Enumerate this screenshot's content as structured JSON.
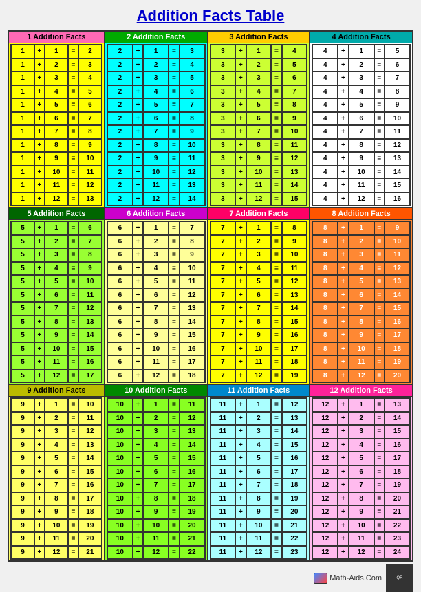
{
  "title": "Addition Facts Table",
  "sections": [
    {
      "id": 1,
      "header": "1 Addition Facts",
      "colorClass": "s1",
      "base": 1,
      "facts": [
        {
          "a": 1,
          "op": "+",
          "b": 1,
          "eq": "=",
          "r": 2
        },
        {
          "a": 1,
          "op": "+",
          "b": 2,
          "eq": "=",
          "r": 3
        },
        {
          "a": 1,
          "op": "+",
          "b": 3,
          "eq": "=",
          "r": 4
        },
        {
          "a": 1,
          "op": "+",
          "b": 4,
          "eq": "=",
          "r": 5
        },
        {
          "a": 1,
          "op": "+",
          "b": 5,
          "eq": "=",
          "r": 6
        },
        {
          "a": 1,
          "op": "+",
          "b": 6,
          "eq": "=",
          "r": 7
        },
        {
          "a": 1,
          "op": "+",
          "b": 7,
          "eq": "=",
          "r": 8
        },
        {
          "a": 1,
          "op": "+",
          "b": 8,
          "eq": "=",
          "r": 9
        },
        {
          "a": 1,
          "op": "+",
          "b": 9,
          "eq": "=",
          "r": 10
        },
        {
          "a": 1,
          "op": "+",
          "b": 10,
          "eq": "=",
          "r": 11
        },
        {
          "a": 1,
          "op": "+",
          "b": 11,
          "eq": "=",
          "r": 12
        },
        {
          "a": 1,
          "op": "+",
          "b": 12,
          "eq": "=",
          "r": 13
        }
      ]
    },
    {
      "id": 2,
      "header": "2 Addition Facts",
      "colorClass": "s2",
      "base": 2,
      "facts": [
        {
          "a": 2,
          "op": "+",
          "b": 1,
          "eq": "=",
          "r": 3
        },
        {
          "a": 2,
          "op": "+",
          "b": 2,
          "eq": "=",
          "r": 4
        },
        {
          "a": 2,
          "op": "+",
          "b": 3,
          "eq": "=",
          "r": 5
        },
        {
          "a": 2,
          "op": "+",
          "b": 4,
          "eq": "=",
          "r": 6
        },
        {
          "a": 2,
          "op": "+",
          "b": 5,
          "eq": "=",
          "r": 7
        },
        {
          "a": 2,
          "op": "+",
          "b": 6,
          "eq": "=",
          "r": 8
        },
        {
          "a": 2,
          "op": "+",
          "b": 7,
          "eq": "=",
          "r": 9
        },
        {
          "a": 2,
          "op": "+",
          "b": 8,
          "eq": "=",
          "r": 10
        },
        {
          "a": 2,
          "op": "+",
          "b": 9,
          "eq": "=",
          "r": 11
        },
        {
          "a": 2,
          "op": "+",
          "b": 10,
          "eq": "=",
          "r": 12
        },
        {
          "a": 2,
          "op": "+",
          "b": 11,
          "eq": "=",
          "r": 13
        },
        {
          "a": 2,
          "op": "+",
          "b": 12,
          "eq": "=",
          "r": 14
        }
      ]
    },
    {
      "id": 3,
      "header": "3 Addition Facts",
      "colorClass": "s3",
      "base": 3,
      "facts": [
        {
          "a": 3,
          "op": "+",
          "b": 1,
          "eq": "=",
          "r": 4
        },
        {
          "a": 3,
          "op": "+",
          "b": 2,
          "eq": "=",
          "r": 5
        },
        {
          "a": 3,
          "op": "+",
          "b": 3,
          "eq": "=",
          "r": 6
        },
        {
          "a": 3,
          "op": "+",
          "b": 4,
          "eq": "=",
          "r": 7
        },
        {
          "a": 3,
          "op": "+",
          "b": 5,
          "eq": "=",
          "r": 8
        },
        {
          "a": 3,
          "op": "+",
          "b": 6,
          "eq": "=",
          "r": 9
        },
        {
          "a": 3,
          "op": "+",
          "b": 7,
          "eq": "=",
          "r": 10
        },
        {
          "a": 3,
          "op": "+",
          "b": 8,
          "eq": "=",
          "r": 11
        },
        {
          "a": 3,
          "op": "+",
          "b": 9,
          "eq": "=",
          "r": 12
        },
        {
          "a": 3,
          "op": "+",
          "b": 10,
          "eq": "=",
          "r": 13
        },
        {
          "a": 3,
          "op": "+",
          "b": 11,
          "eq": "=",
          "r": 14
        },
        {
          "a": 3,
          "op": "+",
          "b": 12,
          "eq": "=",
          "r": 15
        }
      ]
    },
    {
      "id": 4,
      "header": "4 Addition Facts",
      "colorClass": "s4",
      "base": 4,
      "facts": [
        {
          "a": 4,
          "op": "+",
          "b": 1,
          "eq": "=",
          "r": 5
        },
        {
          "a": 4,
          "op": "+",
          "b": 2,
          "eq": "=",
          "r": 6
        },
        {
          "a": 4,
          "op": "+",
          "b": 3,
          "eq": "=",
          "r": 7
        },
        {
          "a": 4,
          "op": "+",
          "b": 4,
          "eq": "=",
          "r": 8
        },
        {
          "a": 4,
          "op": "+",
          "b": 5,
          "eq": "=",
          "r": 9
        },
        {
          "a": 4,
          "op": "+",
          "b": 6,
          "eq": "=",
          "r": 10
        },
        {
          "a": 4,
          "op": "+",
          "b": 7,
          "eq": "=",
          "r": 11
        },
        {
          "a": 4,
          "op": "+",
          "b": 8,
          "eq": "=",
          "r": 12
        },
        {
          "a": 4,
          "op": "+",
          "b": 9,
          "eq": "=",
          "r": 13
        },
        {
          "a": 4,
          "op": "+",
          "b": 10,
          "eq": "=",
          "r": 14
        },
        {
          "a": 4,
          "op": "+",
          "b": 11,
          "eq": "=",
          "r": 15
        },
        {
          "a": 4,
          "op": "+",
          "b": 12,
          "eq": "=",
          "r": 16
        }
      ]
    },
    {
      "id": 5,
      "header": "5 Addition Facts",
      "colorClass": "s5",
      "base": 5,
      "facts": [
        {
          "a": 5,
          "op": "+",
          "b": 1,
          "eq": "=",
          "r": 6
        },
        {
          "a": 5,
          "op": "+",
          "b": 2,
          "eq": "=",
          "r": 7
        },
        {
          "a": 5,
          "op": "+",
          "b": 3,
          "eq": "=",
          "r": 8
        },
        {
          "a": 5,
          "op": "+",
          "b": 4,
          "eq": "=",
          "r": 9
        },
        {
          "a": 5,
          "op": "+",
          "b": 5,
          "eq": "=",
          "r": 10
        },
        {
          "a": 5,
          "op": "+",
          "b": 6,
          "eq": "=",
          "r": 11
        },
        {
          "a": 5,
          "op": "+",
          "b": 7,
          "eq": "=",
          "r": 12
        },
        {
          "a": 5,
          "op": "+",
          "b": 8,
          "eq": "=",
          "r": 13
        },
        {
          "a": 5,
          "op": "+",
          "b": 9,
          "eq": "=",
          "r": 14
        },
        {
          "a": 5,
          "op": "+",
          "b": 10,
          "eq": "=",
          "r": 15
        },
        {
          "a": 5,
          "op": "+",
          "b": 11,
          "eq": "=",
          "r": 16
        },
        {
          "a": 5,
          "op": "+",
          "b": 12,
          "eq": "=",
          "r": 17
        }
      ]
    },
    {
      "id": 6,
      "header": "6 Addition Facts",
      "colorClass": "s6",
      "base": 6,
      "facts": [
        {
          "a": 6,
          "op": "+",
          "b": 1,
          "eq": "=",
          "r": 7
        },
        {
          "a": 6,
          "op": "+",
          "b": 2,
          "eq": "=",
          "r": 8
        },
        {
          "a": 6,
          "op": "+",
          "b": 3,
          "eq": "=",
          "r": 9
        },
        {
          "a": 6,
          "op": "+",
          "b": 4,
          "eq": "=",
          "r": 10
        },
        {
          "a": 6,
          "op": "+",
          "b": 5,
          "eq": "=",
          "r": 11
        },
        {
          "a": 6,
          "op": "+",
          "b": 6,
          "eq": "=",
          "r": 12
        },
        {
          "a": 6,
          "op": "+",
          "b": 7,
          "eq": "=",
          "r": 13
        },
        {
          "a": 6,
          "op": "+",
          "b": 8,
          "eq": "=",
          "r": 14
        },
        {
          "a": 6,
          "op": "+",
          "b": 9,
          "eq": "=",
          "r": 15
        },
        {
          "a": 6,
          "op": "+",
          "b": 10,
          "eq": "=",
          "r": 16
        },
        {
          "a": 6,
          "op": "+",
          "b": 11,
          "eq": "=",
          "r": 17
        },
        {
          "a": 6,
          "op": "+",
          "b": 12,
          "eq": "=",
          "r": 18
        }
      ]
    },
    {
      "id": 7,
      "header": "7 Addition Facts",
      "colorClass": "s7",
      "base": 7,
      "facts": [
        {
          "a": 7,
          "op": "+",
          "b": 1,
          "eq": "=",
          "r": 8
        },
        {
          "a": 7,
          "op": "+",
          "b": 2,
          "eq": "=",
          "r": 9
        },
        {
          "a": 7,
          "op": "+",
          "b": 3,
          "eq": "=",
          "r": 10
        },
        {
          "a": 7,
          "op": "+",
          "b": 4,
          "eq": "=",
          "r": 11
        },
        {
          "a": 7,
          "op": "+",
          "b": 5,
          "eq": "=",
          "r": 12
        },
        {
          "a": 7,
          "op": "+",
          "b": 6,
          "eq": "=",
          "r": 13
        },
        {
          "a": 7,
          "op": "+",
          "b": 7,
          "eq": "=",
          "r": 14
        },
        {
          "a": 7,
          "op": "+",
          "b": 8,
          "eq": "=",
          "r": 15
        },
        {
          "a": 7,
          "op": "+",
          "b": 9,
          "eq": "=",
          "r": 16
        },
        {
          "a": 7,
          "op": "+",
          "b": 10,
          "eq": "=",
          "r": 17
        },
        {
          "a": 7,
          "op": "+",
          "b": 11,
          "eq": "=",
          "r": 18
        },
        {
          "a": 7,
          "op": "+",
          "b": 12,
          "eq": "=",
          "r": 19
        }
      ]
    },
    {
      "id": 8,
      "header": "8 Addition Facts",
      "colorClass": "s8",
      "base": 8,
      "facts": [
        {
          "a": 8,
          "op": "+",
          "b": 1,
          "eq": "=",
          "r": 9
        },
        {
          "a": 8,
          "op": "+",
          "b": 2,
          "eq": "=",
          "r": 10
        },
        {
          "a": 8,
          "op": "+",
          "b": 3,
          "eq": "=",
          "r": 11
        },
        {
          "a": 8,
          "op": "+",
          "b": 4,
          "eq": "=",
          "r": 12
        },
        {
          "a": 8,
          "op": "+",
          "b": 5,
          "eq": "=",
          "r": 13
        },
        {
          "a": 8,
          "op": "+",
          "b": 6,
          "eq": "=",
          "r": 14
        },
        {
          "a": 8,
          "op": "+",
          "b": 7,
          "eq": "=",
          "r": 15
        },
        {
          "a": 8,
          "op": "+",
          "b": 8,
          "eq": "=",
          "r": 16
        },
        {
          "a": 8,
          "op": "+",
          "b": 9,
          "eq": "=",
          "r": 17
        },
        {
          "a": 8,
          "op": "+",
          "b": 10,
          "eq": "=",
          "r": 18
        },
        {
          "a": 8,
          "op": "+",
          "b": 11,
          "eq": "=",
          "r": 19
        },
        {
          "a": 8,
          "op": "+",
          "b": 12,
          "eq": "=",
          "r": 20
        }
      ]
    },
    {
      "id": 9,
      "header": "9 Addition Facts",
      "colorClass": "s9",
      "base": 9,
      "facts": [
        {
          "a": 9,
          "op": "+",
          "b": 1,
          "eq": "=",
          "r": 10
        },
        {
          "a": 9,
          "op": "+",
          "b": 2,
          "eq": "=",
          "r": 11
        },
        {
          "a": 9,
          "op": "+",
          "b": 3,
          "eq": "=",
          "r": 12
        },
        {
          "a": 9,
          "op": "+",
          "b": 4,
          "eq": "=",
          "r": 13
        },
        {
          "a": 9,
          "op": "+",
          "b": 5,
          "eq": "=",
          "r": 14
        },
        {
          "a": 9,
          "op": "+",
          "b": 6,
          "eq": "=",
          "r": 15
        },
        {
          "a": 9,
          "op": "+",
          "b": 7,
          "eq": "=",
          "r": 16
        },
        {
          "a": 9,
          "op": "+",
          "b": 8,
          "eq": "=",
          "r": 17
        },
        {
          "a": 9,
          "op": "+",
          "b": 9,
          "eq": "=",
          "r": 18
        },
        {
          "a": 9,
          "op": "+",
          "b": 10,
          "eq": "=",
          "r": 19
        },
        {
          "a": 9,
          "op": "+",
          "b": 11,
          "eq": "=",
          "r": 20
        },
        {
          "a": 9,
          "op": "+",
          "b": 12,
          "eq": "=",
          "r": 21
        }
      ]
    },
    {
      "id": 10,
      "header": "10 Addition Facts",
      "colorClass": "s10",
      "base": 10,
      "facts": [
        {
          "a": 10,
          "op": "+",
          "b": 1,
          "eq": "=",
          "r": 11
        },
        {
          "a": 10,
          "op": "+",
          "b": 2,
          "eq": "=",
          "r": 12
        },
        {
          "a": 10,
          "op": "+",
          "b": 3,
          "eq": "=",
          "r": 13
        },
        {
          "a": 10,
          "op": "+",
          "b": 4,
          "eq": "=",
          "r": 14
        },
        {
          "a": 10,
          "op": "+",
          "b": 5,
          "eq": "=",
          "r": 15
        },
        {
          "a": 10,
          "op": "+",
          "b": 6,
          "eq": "=",
          "r": 16
        },
        {
          "a": 10,
          "op": "+",
          "b": 7,
          "eq": "=",
          "r": 17
        },
        {
          "a": 10,
          "op": "+",
          "b": 8,
          "eq": "=",
          "r": 18
        },
        {
          "a": 10,
          "op": "+",
          "b": 9,
          "eq": "=",
          "r": 19
        },
        {
          "a": 10,
          "op": "+",
          "b": 10,
          "eq": "=",
          "r": 20
        },
        {
          "a": 10,
          "op": "+",
          "b": 11,
          "eq": "=",
          "r": 21
        },
        {
          "a": 10,
          "op": "+",
          "b": 12,
          "eq": "=",
          "r": 22
        }
      ]
    },
    {
      "id": 11,
      "header": "11 Addition Facts",
      "colorClass": "s11",
      "base": 11,
      "facts": [
        {
          "a": 11,
          "op": "+",
          "b": 1,
          "eq": "=",
          "r": 12
        },
        {
          "a": 11,
          "op": "+",
          "b": 2,
          "eq": "=",
          "r": 13
        },
        {
          "a": 11,
          "op": "+",
          "b": 3,
          "eq": "=",
          "r": 14
        },
        {
          "a": 11,
          "op": "+",
          "b": 4,
          "eq": "=",
          "r": 15
        },
        {
          "a": 11,
          "op": "+",
          "b": 5,
          "eq": "=",
          "r": 16
        },
        {
          "a": 11,
          "op": "+",
          "b": 6,
          "eq": "=",
          "r": 17
        },
        {
          "a": 11,
          "op": "+",
          "b": 7,
          "eq": "=",
          "r": 18
        },
        {
          "a": 11,
          "op": "+",
          "b": 8,
          "eq": "=",
          "r": 19
        },
        {
          "a": 11,
          "op": "+",
          "b": 9,
          "eq": "=",
          "r": 20
        },
        {
          "a": 11,
          "op": "+",
          "b": 10,
          "eq": "=",
          "r": 21
        },
        {
          "a": 11,
          "op": "+",
          "b": 11,
          "eq": "=",
          "r": 22
        },
        {
          "a": 11,
          "op": "+",
          "b": 12,
          "eq": "=",
          "r": 23
        }
      ]
    },
    {
      "id": 12,
      "header": "12 Addition Facts",
      "colorClass": "s12",
      "base": 12,
      "facts": [
        {
          "a": 12,
          "op": "+",
          "b": 1,
          "eq": "=",
          "r": 13
        },
        {
          "a": 12,
          "op": "+",
          "b": 2,
          "eq": "=",
          "r": 14
        },
        {
          "a": 12,
          "op": "+",
          "b": 3,
          "eq": "=",
          "r": 15
        },
        {
          "a": 12,
          "op": "+",
          "b": 4,
          "eq": "=",
          "r": 16
        },
        {
          "a": 12,
          "op": "+",
          "b": 5,
          "eq": "=",
          "r": 17
        },
        {
          "a": 12,
          "op": "+",
          "b": 6,
          "eq": "=",
          "r": 18
        },
        {
          "a": 12,
          "op": "+",
          "b": 7,
          "eq": "=",
          "r": 19
        },
        {
          "a": 12,
          "op": "+",
          "b": 8,
          "eq": "=",
          "r": 20
        },
        {
          "a": 12,
          "op": "+",
          "b": 9,
          "eq": "=",
          "r": 21
        },
        {
          "a": 12,
          "op": "+",
          "b": 10,
          "eq": "=",
          "r": 22
        },
        {
          "a": 12,
          "op": "+",
          "b": 11,
          "eq": "=",
          "r": 23
        },
        {
          "a": 12,
          "op": "+",
          "b": 12,
          "eq": "=",
          "r": 24
        }
      ]
    }
  ],
  "footer": {
    "brand": "Math-Aids.Com"
  }
}
